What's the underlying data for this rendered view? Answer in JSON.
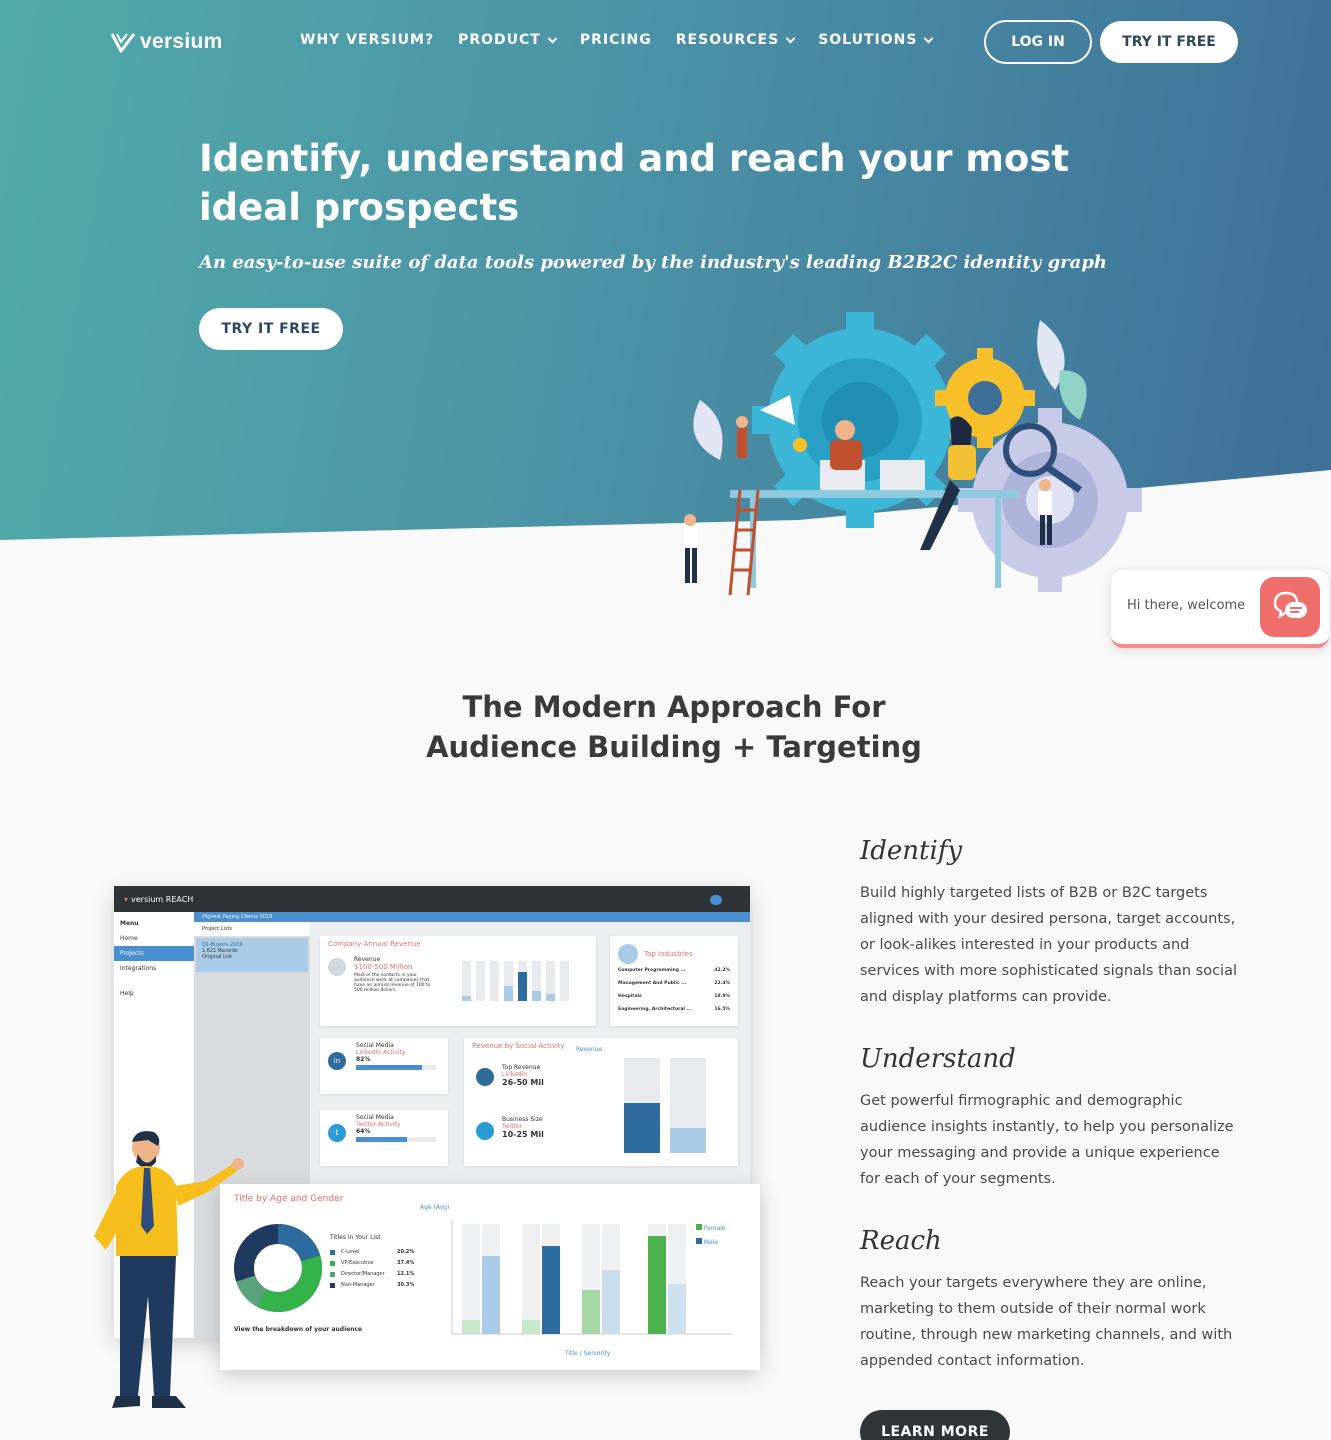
{
  "brand": {
    "name": "versium"
  },
  "nav": {
    "items": [
      {
        "label": "WHY VERSIUM?",
        "dropdown": false
      },
      {
        "label": "PRODUCT",
        "dropdown": true
      },
      {
        "label": "PRICING",
        "dropdown": false
      },
      {
        "label": "RESOURCES",
        "dropdown": true
      },
      {
        "label": "SOLUTIONS",
        "dropdown": true
      }
    ],
    "login": "LOG IN",
    "try_free": "TRY IT FREE"
  },
  "hero": {
    "title": "Identify, understand and reach your most ideal prospects",
    "subtitle": "An easy-to-use suite of data tools powered by the industry's leading B2B2C identity graph",
    "cta": "TRY IT FREE"
  },
  "chat": {
    "greeting": "Hi there, welcome"
  },
  "section": {
    "title_line1": "The Modern Approach For",
    "title_line2": "Audience Building + Targeting"
  },
  "features": [
    {
      "title": "Identify",
      "text": "Build highly targeted lists of B2B or B2C targets aligned with your desired persona, target accounts, or look-alikes interested in your products and services with more sophisticated signals than social and display platforms can provide."
    },
    {
      "title": "Understand",
      "text": "Get powerful firmographic and demographic audience insights instantly, to help you personalize your messaging and provide a unique experience for each of your segments."
    },
    {
      "title": "Reach",
      "text": "Reach your targets everywhere they are online, marketing to them outside of their normal work routine, through new marketing channels, and with appended contact information."
    }
  ],
  "learn_more": "LEARN MORE",
  "dashboard": {
    "app_name": "versium REACH",
    "menu_label": "Menu",
    "menu": [
      "Home",
      "Projects",
      "Integrations",
      "Help"
    ],
    "breadcrumb": "Highest Paying Clients 2019",
    "project_lists": "Project Lists",
    "list_name": "Q1-Buyers-2019",
    "list_records": "1,621 Records",
    "list_type": "Original List",
    "revenue_card": {
      "title": "Company Annual Revenue",
      "label": "Revenue",
      "value": "$100-500 Million",
      "desc": "Most of the contacts in your audience work at companies that have an annual revenue of 100 to 500 million dollars."
    },
    "industries_card": {
      "title": "Top Industries",
      "rows": [
        {
          "name": "Computer Programming ...",
          "pct": "42.2%"
        },
        {
          "name": "Management And Public ...",
          "pct": "22.4%"
        },
        {
          "name": "Hospitals",
          "pct": "18.9%"
        },
        {
          "name": "Engineering, Architectural ...",
          "pct": "16.5%"
        }
      ]
    },
    "linkedin_card": {
      "label": "Social Media",
      "title": "LinkedIn Activity",
      "value": "82%"
    },
    "twitter_card": {
      "label": "Social Media",
      "title": "Twitter Activity",
      "value": "64%"
    },
    "social_rev": {
      "title": "Revenue by Social Activity",
      "top_label": "Top Revenue",
      "top_net": "Linkedin",
      "top_val": "26-50 Mil",
      "size_label": "Business Size",
      "size_net": "Twitter",
      "size_val": "10-25 Mil",
      "chart_label": "Revenue"
    },
    "age_gender": {
      "title": "Title by Age and Gender",
      "axis_label": "Age (Avg)",
      "legend_title": "Titles In Your List",
      "x_label": "Title / Seniority",
      "footer": "View the breakdown of your audience",
      "titles": [
        {
          "name": "C-Level",
          "pct": "20.2%",
          "color": "#2e6b9e"
        },
        {
          "name": "VP/Executive",
          "pct": "37.4%",
          "color": "#33b34a"
        },
        {
          "name": "Director/Manager",
          "pct": "12.1%",
          "color": "#5aa27c"
        },
        {
          "name": "Non-Manager",
          "pct": "30.3%",
          "color": "#1f3a5e"
        }
      ],
      "legend": [
        "Female",
        "Male"
      ]
    }
  }
}
